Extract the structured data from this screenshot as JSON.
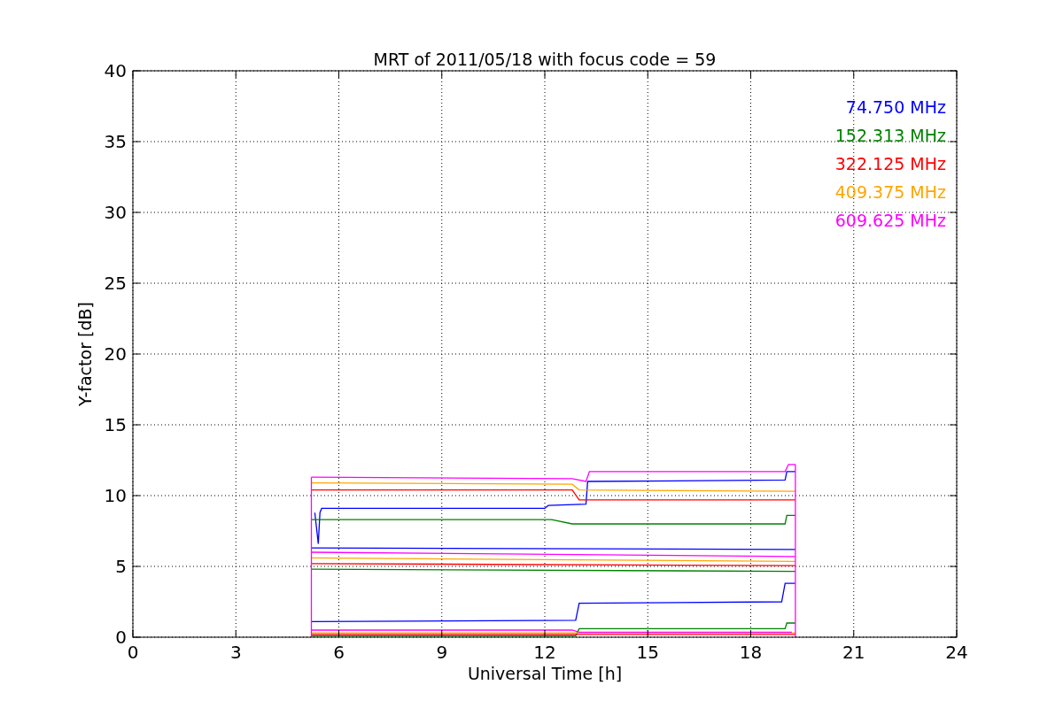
{
  "figure": {
    "chart_data": {
      "type": "line",
      "grid": true,
      "title": "MRT of 2011/05/18 with focus code = 59",
      "xlabel": "Universal Time [h]",
      "ylabel": "Y-factor [dB]",
      "xlim": [
        0,
        24
      ],
      "ylim": [
        0,
        40
      ],
      "xticks": [
        0,
        3,
        6,
        9,
        12,
        15,
        18,
        21,
        24
      ],
      "yticks": [
        0,
        5,
        10,
        15,
        20,
        25,
        30,
        35,
        40
      ],
      "series": [
        {
          "name": "74.750 MHz",
          "color": "#0000ff",
          "x": [
            5.3,
            5.4,
            5.45,
            5.5,
            12,
            12.1,
            13.2,
            13.25,
            19,
            19.05,
            19.3
          ],
          "values": [
            8.8,
            6.6,
            8.8,
            9.1,
            9.1,
            9.3,
            9.4,
            11.0,
            11.1,
            11.7,
            11.7
          ]
        },
        {
          "name": "152.313 MHz",
          "color": "#008000",
          "x": [
            5.2,
            12.2,
            12.8,
            19.0,
            19.05,
            19.3
          ],
          "values": [
            8.3,
            8.3,
            8.0,
            8.0,
            8.6,
            8.6
          ]
        },
        {
          "name": "322.125 MHz",
          "color": "#ff0000",
          "x": [
            5.2,
            12.8,
            13.0,
            19.3
          ],
          "values": [
            10.4,
            10.4,
            9.7,
            9.7
          ]
        },
        {
          "name": "409.375 MHz",
          "color": "#ffa500",
          "x": [
            5.2,
            12.8,
            13.0,
            19.3
          ],
          "values": [
            10.9,
            10.8,
            10.4,
            10.3
          ]
        },
        {
          "name": "609.625 MHz",
          "color": "#ff00ff",
          "x": [
            5.2,
            12.8,
            13.2,
            13.3,
            19.0,
            19.1,
            19.3
          ],
          "values": [
            11.3,
            11.2,
            11.0,
            11.7,
            11.7,
            12.2,
            12.2
          ]
        },
        {
          "color": "#0000ff",
          "x": [
            5.2,
            12.9,
            13.0,
            18.9,
            19.0,
            19.3
          ],
          "values": [
            1.1,
            1.2,
            2.4,
            2.5,
            3.8,
            3.8
          ]
        },
        {
          "color": "#008000",
          "x": [
            5.2,
            12.9,
            13.0,
            19.0,
            19.05,
            19.3
          ],
          "values": [
            0.1,
            0.1,
            0.6,
            0.6,
            1.0,
            1.0
          ]
        },
        {
          "color": "#ff0000",
          "x": [
            5.2,
            19.3
          ],
          "values": [
            0.2,
            0.2
          ]
        },
        {
          "color": "#ffa500",
          "x": [
            5.2,
            19.3
          ],
          "values": [
            0.3,
            0.3
          ]
        },
        {
          "color": "#ff00ff",
          "x": [
            5.2,
            12.8,
            13.0,
            19.2
          ],
          "values": [
            0.5,
            0.5,
            0.35,
            0.35
          ]
        },
        {
          "color": "#0000ff",
          "x": [
            5.2,
            19.3
          ],
          "values": [
            6.3,
            6.2
          ]
        },
        {
          "color": "#008000",
          "x": [
            5.2,
            19.3
          ],
          "values": [
            4.8,
            4.65
          ]
        },
        {
          "color": "#ff0000",
          "x": [
            5.2,
            19.3
          ],
          "values": [
            5.2,
            5.05
          ]
        },
        {
          "color": "#ffa500",
          "x": [
            5.2,
            19.3
          ],
          "values": [
            5.6,
            5.35
          ]
        },
        {
          "color": "#ff00ff",
          "x": [
            5.2,
            19.3
          ],
          "values": [
            6.0,
            5.7
          ]
        },
        {
          "color": "#ff00ff",
          "x": [
            5.2,
            5.2
          ],
          "values": [
            0,
            11.3
          ]
        },
        {
          "color": "#ff00ff",
          "x": [
            19.3,
            19.3
          ],
          "values": [
            0,
            12.2
          ]
        }
      ]
    }
  }
}
